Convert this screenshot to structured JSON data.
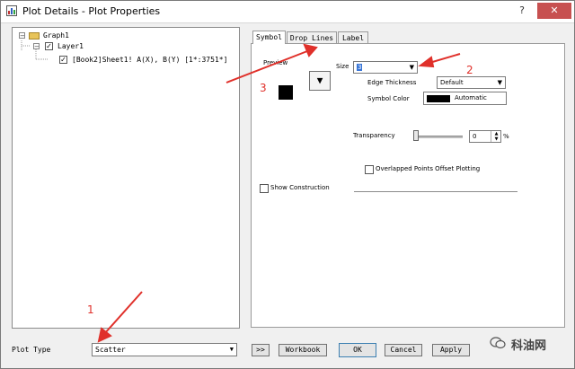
{
  "window": {
    "title": "Plot Details - Plot Properties",
    "help_glyph": "?",
    "close_glyph": "✕"
  },
  "tree": {
    "graph_label": "Graph1",
    "layer_label": "Layer1",
    "dataset_label": "[Book2]Sheet1! A(X), B(Y) [1*:3751*]",
    "expand_glyph": "−",
    "check_glyph": "✓"
  },
  "tabs": [
    {
      "label": "Symbol",
      "active": true
    },
    {
      "label": "Drop Lines",
      "active": false
    },
    {
      "label": "Label",
      "active": false
    }
  ],
  "symbol": {
    "preview_label": "Preview",
    "shape_button_glyph": "▼",
    "size_label": "Size",
    "size_value": "3",
    "edge_thickness_label": "Edge Thickness",
    "edge_thickness_value": "Default",
    "symbol_color_label": "Symbol Color",
    "symbol_color_value": "Automatic",
    "symbol_color_swatch": "#000000",
    "transparency_label": "Transparency",
    "transparency_value": "0",
    "transparency_unit": "%",
    "overlapped_label": "Overlapped Points Offset Plotting",
    "show_construction_label": "Show Construction"
  },
  "footer": {
    "plot_type_label": "Plot Type",
    "plot_type_value": "Scatter",
    "more_label": ">>",
    "workbook_label": "Workbook",
    "ok_label": "OK",
    "cancel_label": "Cancel",
    "apply_label": "Apply"
  },
  "annotations": {
    "one": "1",
    "two": "2",
    "three": "3",
    "color": "#e0302a"
  },
  "watermark": {
    "text": "科油网"
  }
}
